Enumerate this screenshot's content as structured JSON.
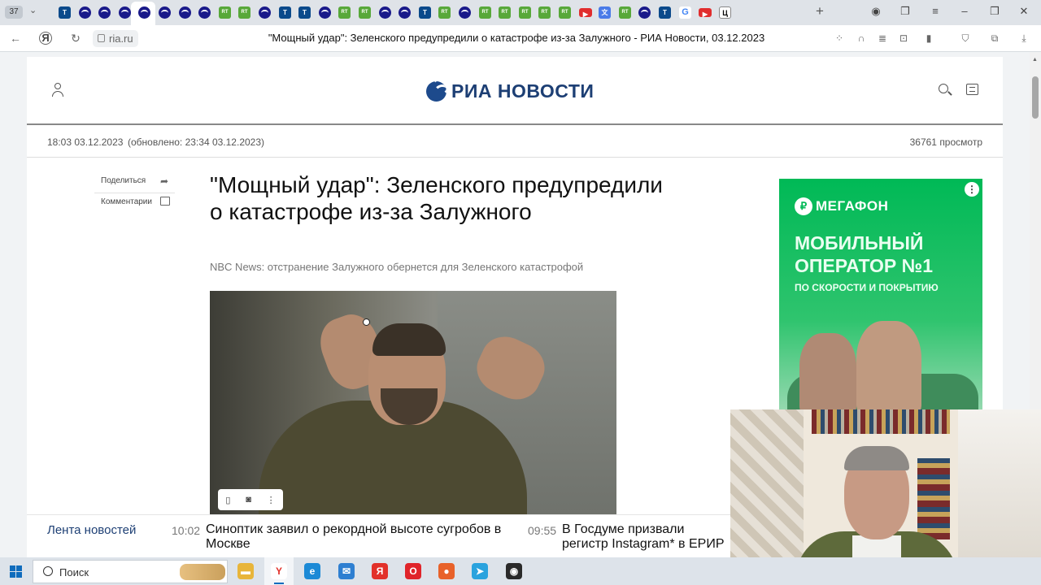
{
  "browser": {
    "tab_count": "37",
    "tab_favicons": [
      {
        "kind": "t",
        "label": "T"
      },
      {
        "kind": "r",
        "label": ""
      },
      {
        "kind": "r",
        "label": ""
      },
      {
        "kind": "r",
        "label": ""
      },
      {
        "kind": "r",
        "label": ""
      },
      {
        "kind": "r",
        "label": ""
      },
      {
        "kind": "r",
        "label": ""
      },
      {
        "kind": "r",
        "label": ""
      },
      {
        "kind": "rt",
        "label": "RT"
      },
      {
        "kind": "rt",
        "label": "RT"
      },
      {
        "kind": "r",
        "label": ""
      },
      {
        "kind": "t",
        "label": "T"
      },
      {
        "kind": "t",
        "label": "T"
      },
      {
        "kind": "r",
        "label": ""
      },
      {
        "kind": "rt",
        "label": "RT"
      },
      {
        "kind": "rt",
        "label": "RT"
      },
      {
        "kind": "r",
        "label": ""
      },
      {
        "kind": "r",
        "label": ""
      },
      {
        "kind": "t",
        "label": "T"
      },
      {
        "kind": "rt",
        "label": "RT"
      },
      {
        "kind": "r",
        "label": ""
      },
      {
        "kind": "rt",
        "label": "RT"
      },
      {
        "kind": "rt",
        "label": "RT"
      },
      {
        "kind": "rt",
        "label": "RT"
      },
      {
        "kind": "rt",
        "label": "RT"
      },
      {
        "kind": "rt",
        "label": "RT"
      },
      {
        "kind": "yt",
        "label": "▶"
      },
      {
        "kind": "tr",
        "label": "文"
      },
      {
        "kind": "rt",
        "label": "RT"
      },
      {
        "kind": "r",
        "label": ""
      },
      {
        "kind": "t",
        "label": "T"
      },
      {
        "kind": "g",
        "label": "G"
      },
      {
        "kind": "yt",
        "label": "▶"
      },
      {
        "kind": "v",
        "label": "Ц"
      }
    ],
    "address": "ria.ru",
    "page_title": "\"Мощный удар\": Зеленского предупредили о катастрофе из-за Залужного - РИА Новости, 03.12.2023",
    "yandex_icon_label": "Я"
  },
  "site": {
    "logo_text": "РИА НОВОСТИ",
    "date": "18:03 03.12.2023",
    "updated": "(обновлено: 23:34 03.12.2023)",
    "views": "36761 просмотр",
    "share_label": "Поделиться",
    "comments_label": "Комментарии"
  },
  "article": {
    "headline": "\"Мощный удар\": Зеленского предупредили о катастрофе из-за Залужного",
    "subhead": "NBC News: отстранение Залужного обернется для Зеленского катастрофой"
  },
  "ad": {
    "brand": "МЕГАФОН",
    "brand_icon": "₽",
    "title": "МОБИЛЬНЫЙ ОПЕРАТОР №1",
    "subtitle": "ПО СКОРОСТИ И ПОКРЫТИЮ",
    "brand_color": "#00b956"
  },
  "ticker": {
    "label": "Лента новостей",
    "items": [
      {
        "time": "10:02",
        "text": "Синоптик заявил о рекордной высоте сугробов в Москве"
      },
      {
        "time": "09:55",
        "text": "В Госдуме призвали регистр Instagram* в ЕРИР"
      }
    ]
  },
  "taskbar": {
    "search_placeholder": "Поиск",
    "apps": [
      {
        "name": "file-explorer",
        "glyph": "▬",
        "color": "#e8b53a"
      },
      {
        "name": "yandex-browser",
        "glyph": "Y",
        "color": "#ffffff"
      },
      {
        "name": "edge",
        "glyph": "e",
        "color": "#1c8ad6"
      },
      {
        "name": "mail",
        "glyph": "✉",
        "color": "#2e7fd1"
      },
      {
        "name": "yandex",
        "glyph": "Я",
        "color": "#e2312a"
      },
      {
        "name": "opera",
        "glyph": "O",
        "color": "#e0242a"
      },
      {
        "name": "firefox",
        "glyph": "●",
        "color": "#e8622a"
      },
      {
        "name": "telegram",
        "glyph": "➤",
        "color": "#2aa3de"
      },
      {
        "name": "obs",
        "glyph": "◉",
        "color": "#2a2a2a"
      }
    ]
  }
}
